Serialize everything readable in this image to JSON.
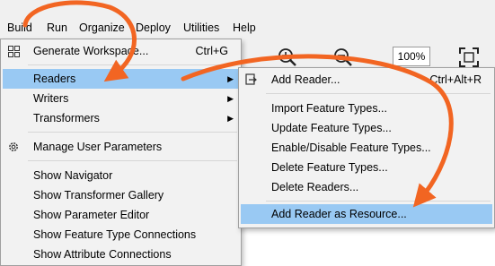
{
  "menubar": {
    "items": [
      "Build",
      "Run",
      "Organize",
      "Deploy",
      "Utilities",
      "Help"
    ]
  },
  "toolbar": {
    "zoom": "100%",
    "icons": [
      "zoom-in-icon",
      "zoom-out-icon",
      "fit-view-icon"
    ]
  },
  "build_menu": {
    "generate": {
      "label": "Generate Workspace...",
      "shortcut": "Ctrl+G"
    },
    "readers": "Readers",
    "writers": "Writers",
    "transformers": "Transformers",
    "manage_params": "Manage User Parameters",
    "show_navigator": "Show Navigator",
    "show_gallery": "Show Transformer Gallery",
    "show_param_editor": "Show Parameter Editor",
    "show_ft_connections": "Show Feature Type Connections",
    "show_attr_connections": "Show Attribute Connections"
  },
  "readers_menu": {
    "add_reader": {
      "label": "Add Reader...",
      "shortcut": "Ctrl+Alt+R"
    },
    "import_ft": "Import Feature Types...",
    "update_ft": "Update Feature Types...",
    "enable_disable_ft": "Enable/Disable Feature Types...",
    "delete_ft": "Delete Feature Types...",
    "delete_readers": "Delete Readers...",
    "add_as_resource": "Add Reader as Resource..."
  },
  "colors": {
    "highlight": "#99c9f3",
    "annotation": "#f26522",
    "menu_bg": "#f2f2f2"
  }
}
